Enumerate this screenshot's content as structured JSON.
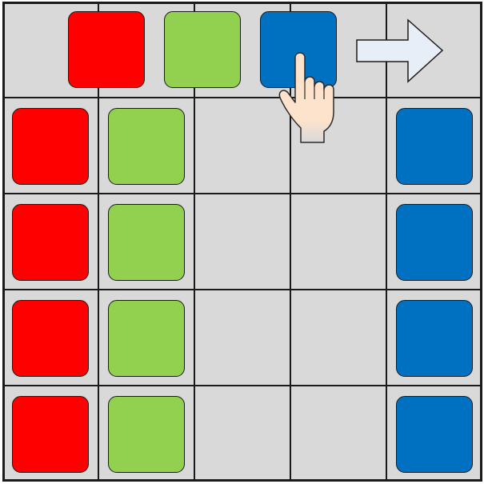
{
  "board": {
    "rows": 5,
    "cols": 5,
    "colors": {
      "red": "#ff0000",
      "green": "#92d050",
      "blue": "#0070c0",
      "empty": "#d9d9d9"
    },
    "selector_row": [
      "red",
      "green",
      "blue"
    ],
    "grid": [
      [
        "red",
        "green",
        null,
        null,
        "blue"
      ],
      [
        "red",
        "green",
        null,
        null,
        "blue"
      ],
      [
        "red",
        "green",
        null,
        null,
        "blue"
      ],
      [
        "red",
        "green",
        null,
        null,
        "blue"
      ]
    ]
  },
  "icons": {
    "arrow": "right-arrow-icon",
    "hand": "pointing-hand-icon"
  }
}
